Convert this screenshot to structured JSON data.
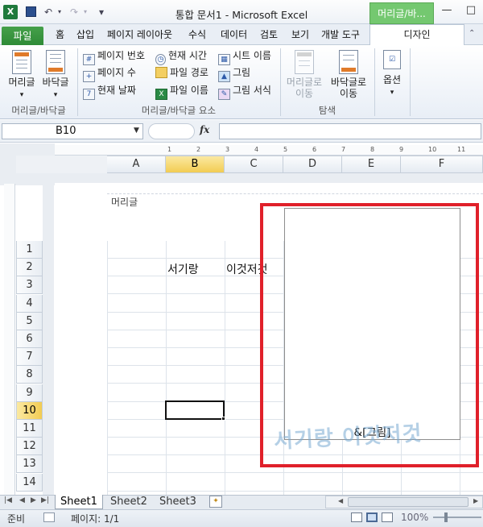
{
  "window": {
    "title": "통합 문서1 - Microsoft Excel",
    "context_tab_title": "머리글/바...",
    "buttons": [
      "—",
      "□",
      "✕"
    ]
  },
  "quick_access": {
    "undo": "↶",
    "redo": "↷",
    "customize": "▾"
  },
  "tabs": {
    "file": "파일",
    "items": [
      "홈",
      "삽입",
      "페이지 레이아웃",
      "수식",
      "데이터",
      "검토",
      "보기",
      "개발 도구"
    ],
    "design": "디자인"
  },
  "ribbon": {
    "group1": {
      "header": "머리글",
      "footer": "바닥글",
      "label": "머리글/바닥글"
    },
    "group2": {
      "col1": [
        "페이지 번호",
        "페이지 수",
        "현재 날짜"
      ],
      "col2": [
        "현재 시간",
        "파일 경로",
        "파일 이름"
      ],
      "col3": [
        "시트 이름",
        "그림",
        "그림 서식"
      ],
      "label": "머리글/바닥글 요소"
    },
    "group3": {
      "go_header": "머리글로\n이동",
      "go_footer": "바닥글로\n이동",
      "label": "탐색"
    },
    "group4": {
      "options": "옵션"
    }
  },
  "formula_bar": {
    "name_box": "B10",
    "fx": "fx",
    "formula": ""
  },
  "grid": {
    "columns": [
      "A",
      "B",
      "C",
      "D",
      "E",
      "F"
    ],
    "selected_column": "B",
    "rows": [
      "1",
      "2",
      "3",
      "4",
      "5",
      "6",
      "7",
      "8",
      "9",
      "10",
      "11",
      "12",
      "13",
      "14"
    ],
    "selected_row": "10",
    "cells": {
      "B2": "서기랑",
      "C2": "이것저것"
    },
    "header_label": "머리글",
    "ruler_numbers": [
      "1",
      "2",
      "3",
      "4",
      "5",
      "6",
      "7",
      "8",
      "9",
      "10",
      "11"
    ]
  },
  "header_image": {
    "caption": "&[그림]",
    "watermark": "서기랑 이것저것"
  },
  "sheets": [
    "Sheet1",
    "Sheet2",
    "Sheet3"
  ],
  "status": {
    "ready": "준비",
    "page": "페이지: 1/1",
    "zoom": "100%"
  }
}
